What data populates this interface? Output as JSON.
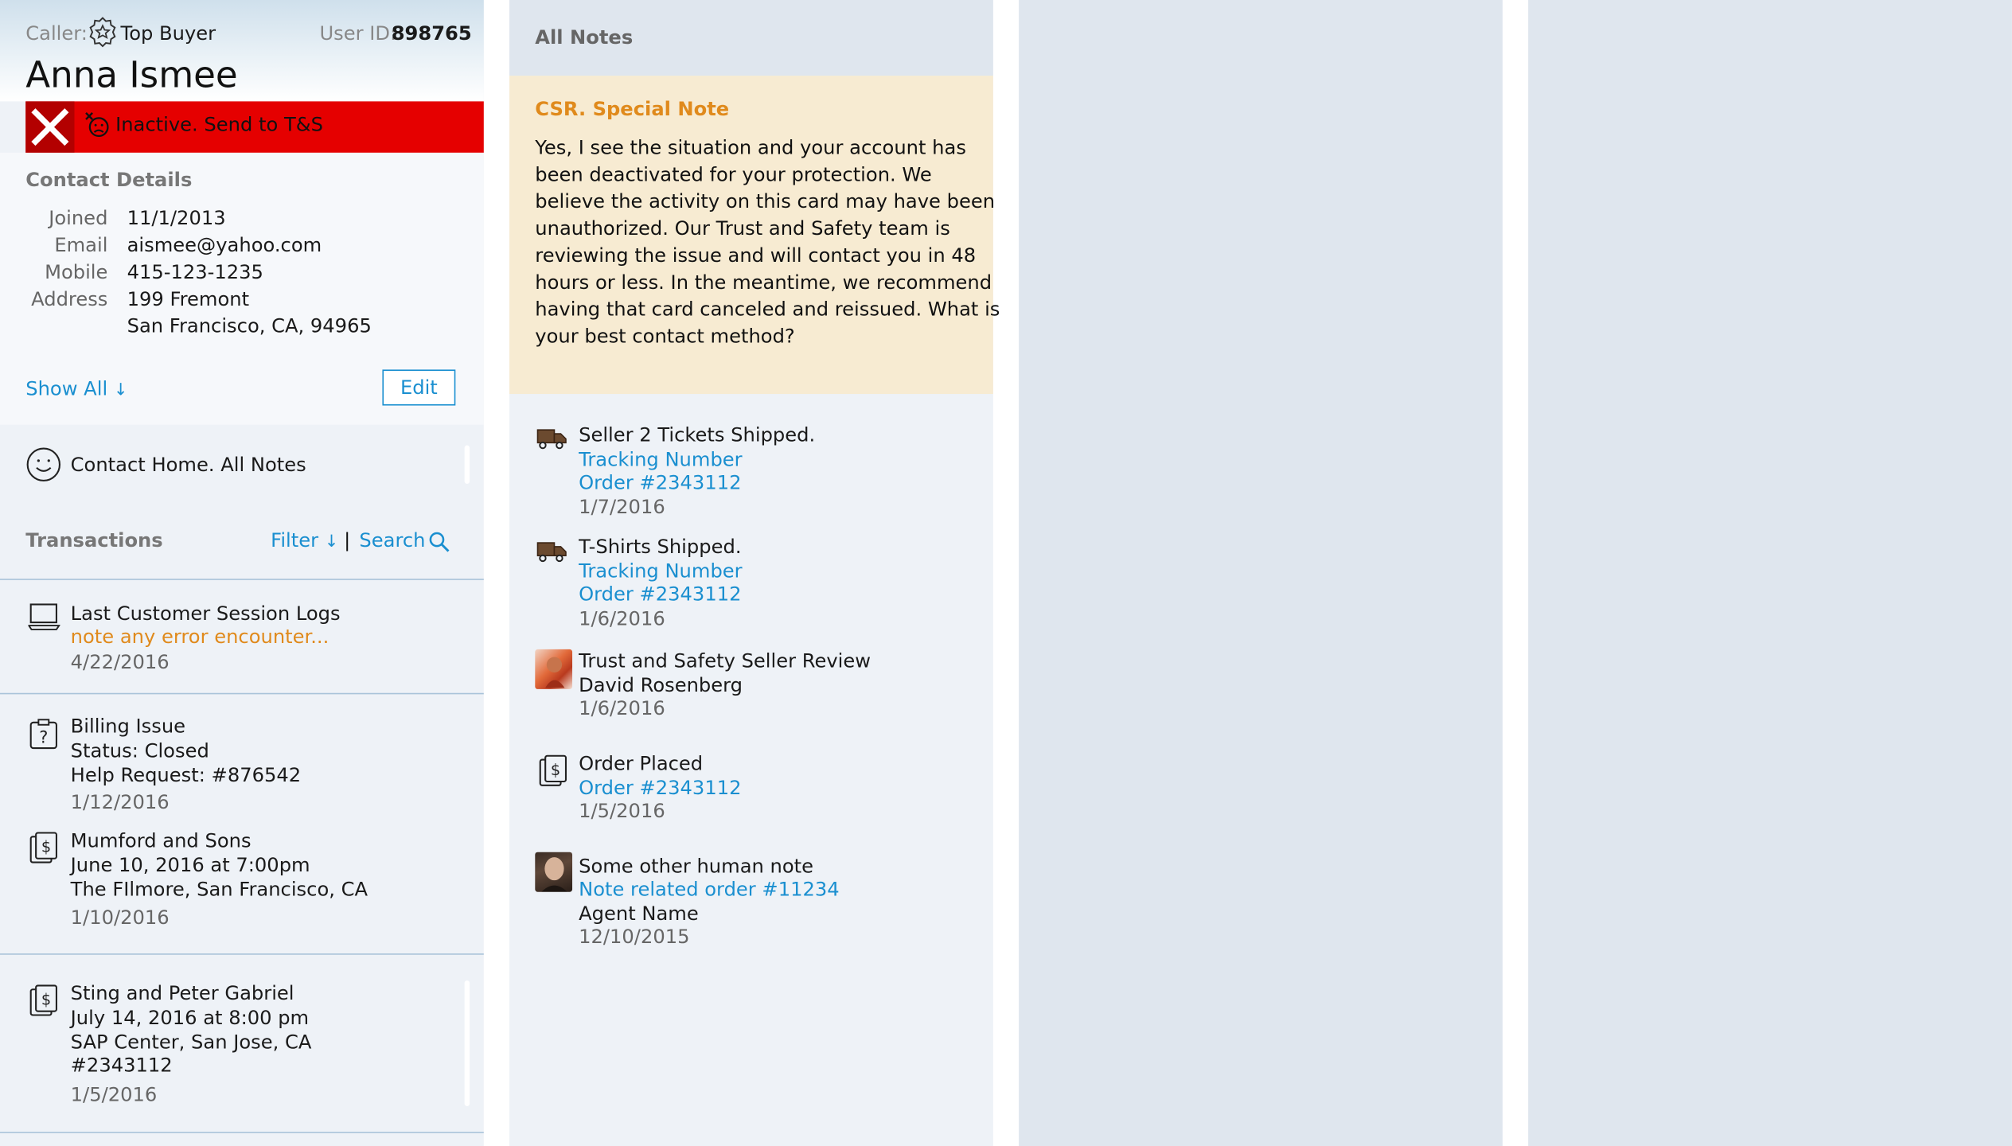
{
  "caller": {
    "caller_label": "Caller:",
    "tier": "Top Buyer",
    "tier_icon": "award-icon",
    "user_id_label": "User ID:",
    "user_id": "898765",
    "name": "Anna Ismee",
    "alert_text": "Inactive. Send to T&S",
    "alert_color": "#e50000"
  },
  "contact_details": {
    "title": "Contact Details",
    "rows": [
      {
        "label": "Joined",
        "value": "11/1/2013"
      },
      {
        "label": "Email",
        "value": "aismee@yahoo.com"
      },
      {
        "label": "Mobile",
        "value": "415-123-1235"
      },
      {
        "label": "Address",
        "value": "199 Fremont"
      }
    ],
    "address_line2": "San Francisco, CA, 94965",
    "show_all": "Show All",
    "edit": "Edit"
  },
  "contact_home": {
    "label": "Contact Home. All Notes"
  },
  "transactions": {
    "title": "Transactions",
    "filter": "Filter",
    "search": "Search",
    "session": {
      "title": "Last Customer Session Logs",
      "note": "note any error encounter...",
      "date": "4/22/2016"
    },
    "billing": {
      "title": "Billing Issue",
      "status": "Status: Closed",
      "help": "Help Request: #876542",
      "date": "1/12/2016"
    },
    "mumford": {
      "title": "Mumford and Sons",
      "when": "June 10, 2016 at 7:00pm",
      "where": "The FIlmore, San Francisco, CA",
      "date": "1/10/2016"
    },
    "sting": {
      "title": "Sting and Peter Gabriel",
      "when": "July 14, 2016 at 8:00 pm",
      "where": "SAP Center, San Jose, CA",
      "order": "#2343112",
      "date": "1/5/2016"
    }
  },
  "notes": {
    "title": "All Notes",
    "csr_title": "CSR. Special Note",
    "csr_lines": [
      "Yes, I see the situation and your account has",
      "been deactivated for your protection.  We",
      "believe the activity on this card may have been",
      "unauthorized. Our Trust and Safety team is",
      "reviewing the issue and will contact you in 48",
      "hours or less. In the meantime, we recommend",
      "having that card canceled and reissued. What is",
      "your best contact method?"
    ],
    "items": [
      {
        "title": "Seller 2 Tickets Shipped.",
        "link1": "Tracking Number",
        "link2": "Order #2343112",
        "date": "1/7/2016"
      },
      {
        "title": "T-Shirts Shipped.",
        "link1": "Tracking Number",
        "link2": "Order #2343112",
        "date": "1/6/2016"
      },
      {
        "title": "Trust and Safety Seller Review",
        "sub": "David Rosenberg",
        "date": "1/6/2016"
      },
      {
        "title": "Order Placed",
        "link1": "Order #2343112",
        "date": "1/5/2016"
      },
      {
        "title": "Some other human note",
        "link1": "Note related order #11234",
        "sub": "Agent Name",
        "date": "12/10/2015"
      }
    ]
  },
  "colors": {
    "link": "#1a8fd0",
    "accent_orange": "#e08a1c",
    "panel_bg": "#eef2f7",
    "csr_bg": "#f7ebd2"
  }
}
